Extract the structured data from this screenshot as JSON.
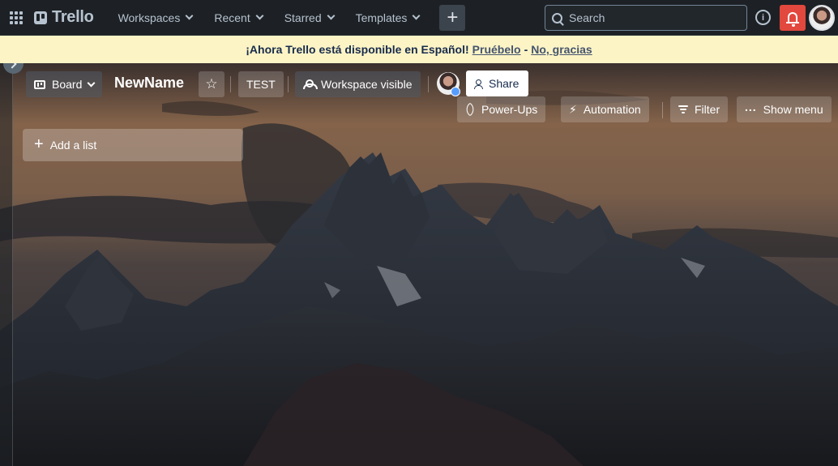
{
  "topnav": {
    "logo_text": "Trello",
    "menus": [
      {
        "label": "Workspaces"
      },
      {
        "label": "Recent"
      },
      {
        "label": "Starred"
      },
      {
        "label": "Templates"
      }
    ],
    "create_label": "+",
    "search_placeholder": "Search",
    "info_label": "i"
  },
  "banner": {
    "message": "¡Ahora Trello está disponible en Español!",
    "try_link": "Pruébelo",
    "separator": "-",
    "dismiss_link": "No, gracias"
  },
  "board": {
    "view_label": "Board",
    "title": "NewName",
    "star_label": "☆",
    "workspace_label": "TEST",
    "visibility_label": "Workspace visible",
    "share_label": "Share",
    "powerups_label": "Power-Ups",
    "automation_label": "Automation",
    "filter_label": "Filter",
    "menu_label": "Show menu",
    "add_list_label": "Add a list"
  },
  "colors": {
    "nav_bg": "#1d2125",
    "banner_bg": "#fdf4c5",
    "notification_red": "#e2483d",
    "share_bg": "#ffffff"
  },
  "icons": [
    "apps-grid-icon",
    "trello-logo-icon",
    "chevron-down-icon",
    "plus-icon",
    "search-icon",
    "info-icon",
    "bell-icon",
    "avatar",
    "board-view-icon",
    "star-icon",
    "people-icon",
    "add-user-icon",
    "rocket-icon",
    "lightning-icon",
    "filter-icon",
    "dots-icon"
  ]
}
